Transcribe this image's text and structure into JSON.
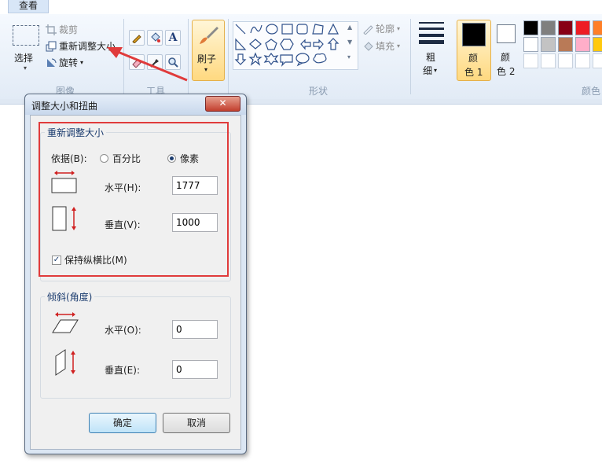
{
  "menu": {
    "view_tab": "查看"
  },
  "ribbon": {
    "image_group": {
      "select_label": "选择",
      "crop_label": "裁剪",
      "resize_label": "重新调整大小",
      "rotate_label": "旋转",
      "group_label": "图像"
    },
    "tools_group": {
      "group_label": "工具"
    },
    "brush_label": "刷子",
    "shapes_group": {
      "outline_label": "轮廓",
      "fill_label": "填充",
      "group_label": "形状"
    },
    "size_label_1": "粗",
    "size_label_2": "细",
    "color1_label_1": "颜",
    "color1_label_2": "色 1",
    "color2_label_1": "颜",
    "color2_label_2": "色 2",
    "colors_group_label": "颜色",
    "palette_row1": [
      "#000000",
      "#7f7f7f",
      "#880015",
      "#ed1c24",
      "#ff7f27"
    ],
    "palette_row2": [
      "#ffffff",
      "#c3c3c3",
      "#b97a57",
      "#ffaec9",
      "#ffc90e"
    ],
    "color1_value": "#000000",
    "color2_value": "#ffffff"
  },
  "dialog": {
    "title": "调整大小和扭曲",
    "close_icon": "close-icon",
    "resize": {
      "legend": "重新调整大小",
      "by_label": "依据(B):",
      "percent_label": "百分比",
      "pixels_label": "像素",
      "selected_mode": "pixels",
      "horizontal_label": "水平(H):",
      "horizontal_value": "1777",
      "vertical_label": "垂直(V):",
      "vertical_value": "1000",
      "keep_ratio_label": "保持纵横比(M)",
      "keep_ratio_checked": true
    },
    "skew": {
      "legend": "倾斜(角度)",
      "horizontal_label": "水平(O):",
      "horizontal_value": "0",
      "vertical_label": "垂直(E):",
      "vertical_value": "0"
    },
    "ok_label": "确定",
    "cancel_label": "取消"
  },
  "annotation": {
    "highlight_color": "#e03b3b"
  }
}
